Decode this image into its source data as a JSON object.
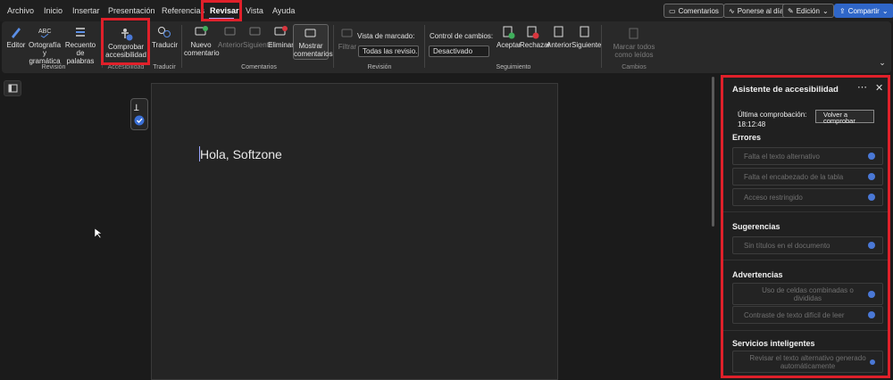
{
  "menu": {
    "tabs": [
      "Archivo",
      "Inicio",
      "Insertar",
      "Presentación",
      "Referencias",
      "Revisar",
      "Vista",
      "Ayuda"
    ],
    "active": "Revisar"
  },
  "top_actions": {
    "comments": "Comentarios",
    "catch_up": "Ponerse al día",
    "editing": "Edición",
    "share": "Compartir"
  },
  "ribbon": {
    "editor": "Editor",
    "spelling": "Ortografía y gramática",
    "word_count": "Recuento de palabras",
    "check_accessibility": "Comprobar accesibilidad",
    "translate": "Traducir",
    "new_comment": "Nuevo comentario",
    "previous": "Anterior",
    "next": "Siguiente",
    "delete": "Eliminar",
    "show_comments": "Mostrar comentarios",
    "filter": "Filtrar",
    "markup_view_label": "Vista de marcado:",
    "markup_view_value": "Todas las revisio.",
    "track_changes_label": "Control de cambios:",
    "track_changes_value": "Desactivado",
    "accept": "Aceptar",
    "reject": "Rechazar",
    "change_previous": "Anterior",
    "change_next": "Siguiente",
    "mark_all_done": "Marcar todos como leídos",
    "groups": {
      "revision": "Revisión",
      "accessibility": "Accesibilidad",
      "translate": "Traducir",
      "comments": "Comentarios",
      "revision2": "Revisión",
      "tracking": "Seguimiento",
      "changes": "Cambios"
    }
  },
  "document": {
    "text": "Hola, Softzone"
  },
  "pane": {
    "title": "Asistente de accesibilidad",
    "last_check_label": "Última comprobación:",
    "last_check_time": "18:12:48",
    "recheck": "Volver a comprobar",
    "sections": {
      "errors": "Errores",
      "suggestions": "Sugerencias",
      "warnings": "Advertencias",
      "intelligent": "Servicios inteligentes"
    },
    "errors": [
      "Falta el texto alternativo",
      "Falta el encabezado de la tabla",
      "Acceso restringido"
    ],
    "suggestions": [
      "Sin títulos en el documento"
    ],
    "warnings": [
      "Uso de celdas combinadas o divididas",
      "Contraste de texto difícil de leer"
    ],
    "intelligent": [
      "Revisar el texto alternativo generado automáticamente"
    ]
  },
  "colors": {
    "highlight_box": "#e0202a",
    "accent": "#2f66c8",
    "status_dot": "#4a78d6"
  }
}
